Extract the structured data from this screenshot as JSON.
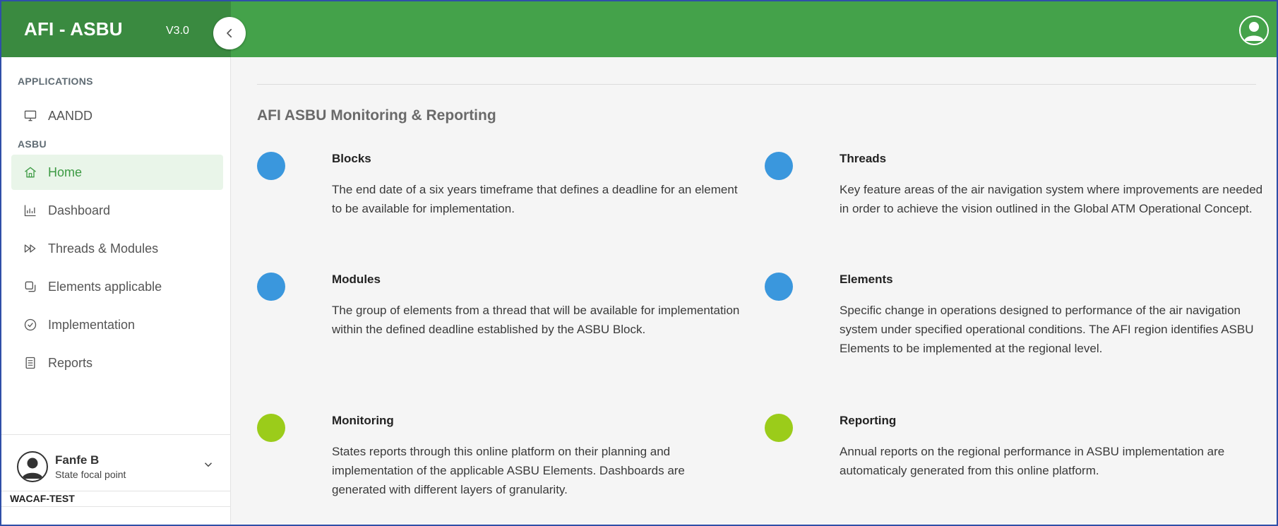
{
  "header": {
    "brand": "AFI - ASBU",
    "version": "V3.0",
    "collapse_icon": "chevron-left-icon",
    "user_icon": "user-avatar-icon"
  },
  "sidebar": {
    "sections": [
      {
        "label": "APPLICATIONS",
        "items": [
          {
            "label": "AANDD",
            "icon": "monitor-icon",
            "active": false
          }
        ]
      },
      {
        "label": "ASBU",
        "items": [
          {
            "label": "Home",
            "icon": "home-icon",
            "active": true
          },
          {
            "label": "Dashboard",
            "icon": "bar-chart-icon",
            "active": false
          },
          {
            "label": "Threads & Modules",
            "icon": "fast-forward-icon",
            "active": false
          },
          {
            "label": "Elements applicable",
            "icon": "copy-icon",
            "active": false
          },
          {
            "label": "Implementation",
            "icon": "check-circle-icon",
            "active": false
          },
          {
            "label": "Reports",
            "icon": "document-icon",
            "active": false
          }
        ]
      }
    ],
    "profile": {
      "name": "Fanfe B",
      "role": "State focal point"
    },
    "org": "WACAF-TEST"
  },
  "main": {
    "title": "AFI ASBU Monitoring & Reporting",
    "cards": [
      {
        "title": "Blocks",
        "description": "The end date of a six years timeframe that defines a deadline for an element to be available for implementation.",
        "color": "#3a97dd"
      },
      {
        "title": "Threads",
        "description": "Key feature areas of the air navigation system where improvements are needed in order to achieve the vision outlined in the Global ATM Operational Concept.",
        "color": "#3a97dd"
      },
      {
        "title": "Modules",
        "description": "The group of elements from a thread that will be available for implementation within the defined deadline established by the ASBU Block.",
        "color": "#3a97dd"
      },
      {
        "title": "Elements",
        "description": "Specific change in operations designed to performance of the air navigation system under specified operational conditions. The AFI region identifies ASBU Elements to be implemented at the regional level.",
        "color": "#3a97dd"
      },
      {
        "title": "Monitoring",
        "description": "States reports through this online platform on their planning and implementation of the applicable ASBU Elements. Dashboards are generated with different layers of granularity.",
        "color": "#9bcc1a"
      },
      {
        "title": "Reporting",
        "description": "Annual reports on the regional performance in ASBU implementation are automaticaly generated from this online platform.",
        "color": "#9bcc1a"
      }
    ]
  },
  "colors": {
    "header_green": "#44a24a",
    "brand_green": "#3a8a40",
    "active_text": "#3c9a43",
    "active_bg": "#e9f5e9"
  }
}
